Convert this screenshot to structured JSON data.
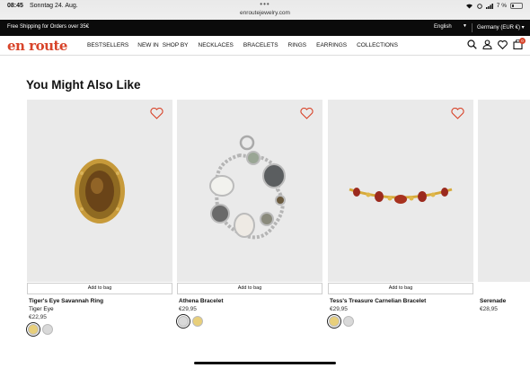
{
  "status_bar": {
    "time": "08:45",
    "date": "Sonntag 24. Aug.",
    "dots": "•••",
    "url": "enroutejewelry.com",
    "battery": "7 %"
  },
  "promo": {
    "text": "Free Shipping for Orders over 35€",
    "language": "English",
    "country": "Germany (EUR €)"
  },
  "header": {
    "logo": "en route",
    "nav": [
      "BESTSELLERS",
      "NEW IN",
      "SHOP BY",
      "NECKLACES",
      "BRACELETS",
      "RINGS",
      "EARRINGS",
      "COLLECTIONS"
    ],
    "cart_count": "0"
  },
  "section": {
    "title": "You Might Also Like"
  },
  "products": [
    {
      "name": "Tiger's Eye Savannah Ring",
      "subtitle": "Tiger Eye",
      "price": "€22,95",
      "add_label": "Add to bag",
      "swatches": [
        "#e8cf7a",
        "#d9d9d9"
      ],
      "selected_swatch": 0
    },
    {
      "name": "Athena Bracelet",
      "subtitle": "",
      "price": "€29,95",
      "add_label": "Add to bag",
      "swatches": [
        "#d9d9d9",
        "#e8cf7a"
      ],
      "selected_swatch": 0
    },
    {
      "name": "Tess's Treasure Carnelian Bracelet",
      "subtitle": "",
      "price": "€29,95",
      "add_label": "Add to bag",
      "swatches": [
        "#e8cf7a",
        "#d9d9d9"
      ],
      "selected_swatch": 0
    },
    {
      "name": "Serenade",
      "subtitle": "",
      "price": "€28,95",
      "add_label": "",
      "swatches": [],
      "selected_swatch": -1
    }
  ],
  "colors": {
    "brand": "#d8442a",
    "promo_bg": "#0b0b0b",
    "card_bg": "#eaeaea"
  }
}
